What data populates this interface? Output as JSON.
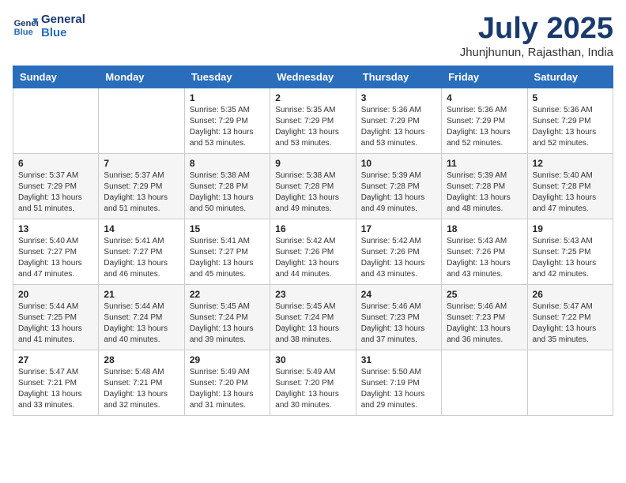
{
  "header": {
    "logo_line1": "General",
    "logo_line2": "Blue",
    "title": "July 2025",
    "subtitle": "Jhunjhunun, Rajasthan, India"
  },
  "days_of_week": [
    "Sunday",
    "Monday",
    "Tuesday",
    "Wednesday",
    "Thursday",
    "Friday",
    "Saturday"
  ],
  "weeks": [
    [
      {
        "day": "",
        "info": ""
      },
      {
        "day": "",
        "info": ""
      },
      {
        "day": "1",
        "info": "Sunrise: 5:35 AM\nSunset: 7:29 PM\nDaylight: 13 hours and 53 minutes."
      },
      {
        "day": "2",
        "info": "Sunrise: 5:35 AM\nSunset: 7:29 PM\nDaylight: 13 hours and 53 minutes."
      },
      {
        "day": "3",
        "info": "Sunrise: 5:36 AM\nSunset: 7:29 PM\nDaylight: 13 hours and 53 minutes."
      },
      {
        "day": "4",
        "info": "Sunrise: 5:36 AM\nSunset: 7:29 PM\nDaylight: 13 hours and 52 minutes."
      },
      {
        "day": "5",
        "info": "Sunrise: 5:36 AM\nSunset: 7:29 PM\nDaylight: 13 hours and 52 minutes."
      }
    ],
    [
      {
        "day": "6",
        "info": "Sunrise: 5:37 AM\nSunset: 7:29 PM\nDaylight: 13 hours and 51 minutes."
      },
      {
        "day": "7",
        "info": "Sunrise: 5:37 AM\nSunset: 7:29 PM\nDaylight: 13 hours and 51 minutes."
      },
      {
        "day": "8",
        "info": "Sunrise: 5:38 AM\nSunset: 7:28 PM\nDaylight: 13 hours and 50 minutes."
      },
      {
        "day": "9",
        "info": "Sunrise: 5:38 AM\nSunset: 7:28 PM\nDaylight: 13 hours and 49 minutes."
      },
      {
        "day": "10",
        "info": "Sunrise: 5:39 AM\nSunset: 7:28 PM\nDaylight: 13 hours and 49 minutes."
      },
      {
        "day": "11",
        "info": "Sunrise: 5:39 AM\nSunset: 7:28 PM\nDaylight: 13 hours and 48 minutes."
      },
      {
        "day": "12",
        "info": "Sunrise: 5:40 AM\nSunset: 7:28 PM\nDaylight: 13 hours and 47 minutes."
      }
    ],
    [
      {
        "day": "13",
        "info": "Sunrise: 5:40 AM\nSunset: 7:27 PM\nDaylight: 13 hours and 47 minutes."
      },
      {
        "day": "14",
        "info": "Sunrise: 5:41 AM\nSunset: 7:27 PM\nDaylight: 13 hours and 46 minutes."
      },
      {
        "day": "15",
        "info": "Sunrise: 5:41 AM\nSunset: 7:27 PM\nDaylight: 13 hours and 45 minutes."
      },
      {
        "day": "16",
        "info": "Sunrise: 5:42 AM\nSunset: 7:26 PM\nDaylight: 13 hours and 44 minutes."
      },
      {
        "day": "17",
        "info": "Sunrise: 5:42 AM\nSunset: 7:26 PM\nDaylight: 13 hours and 43 minutes."
      },
      {
        "day": "18",
        "info": "Sunrise: 5:43 AM\nSunset: 7:26 PM\nDaylight: 13 hours and 43 minutes."
      },
      {
        "day": "19",
        "info": "Sunrise: 5:43 AM\nSunset: 7:25 PM\nDaylight: 13 hours and 42 minutes."
      }
    ],
    [
      {
        "day": "20",
        "info": "Sunrise: 5:44 AM\nSunset: 7:25 PM\nDaylight: 13 hours and 41 minutes."
      },
      {
        "day": "21",
        "info": "Sunrise: 5:44 AM\nSunset: 7:24 PM\nDaylight: 13 hours and 40 minutes."
      },
      {
        "day": "22",
        "info": "Sunrise: 5:45 AM\nSunset: 7:24 PM\nDaylight: 13 hours and 39 minutes."
      },
      {
        "day": "23",
        "info": "Sunrise: 5:45 AM\nSunset: 7:24 PM\nDaylight: 13 hours and 38 minutes."
      },
      {
        "day": "24",
        "info": "Sunrise: 5:46 AM\nSunset: 7:23 PM\nDaylight: 13 hours and 37 minutes."
      },
      {
        "day": "25",
        "info": "Sunrise: 5:46 AM\nSunset: 7:23 PM\nDaylight: 13 hours and 36 minutes."
      },
      {
        "day": "26",
        "info": "Sunrise: 5:47 AM\nSunset: 7:22 PM\nDaylight: 13 hours and 35 minutes."
      }
    ],
    [
      {
        "day": "27",
        "info": "Sunrise: 5:47 AM\nSunset: 7:21 PM\nDaylight: 13 hours and 33 minutes."
      },
      {
        "day": "28",
        "info": "Sunrise: 5:48 AM\nSunset: 7:21 PM\nDaylight: 13 hours and 32 minutes."
      },
      {
        "day": "29",
        "info": "Sunrise: 5:49 AM\nSunset: 7:20 PM\nDaylight: 13 hours and 31 minutes."
      },
      {
        "day": "30",
        "info": "Sunrise: 5:49 AM\nSunset: 7:20 PM\nDaylight: 13 hours and 30 minutes."
      },
      {
        "day": "31",
        "info": "Sunrise: 5:50 AM\nSunset: 7:19 PM\nDaylight: 13 hours and 29 minutes."
      },
      {
        "day": "",
        "info": ""
      },
      {
        "day": "",
        "info": ""
      }
    ]
  ]
}
